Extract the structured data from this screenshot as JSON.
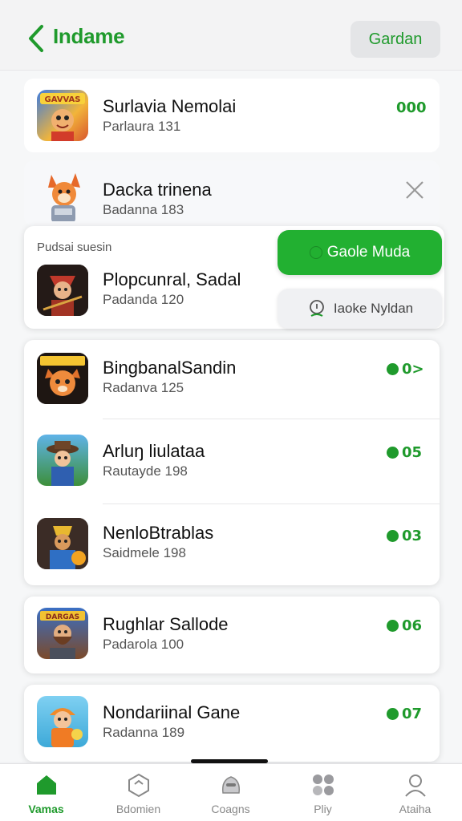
{
  "header": {
    "title": "Indame",
    "action_label": "Gardan"
  },
  "apps": [
    {
      "name": "Surlavia Nemolai",
      "subtitle": "Parlaura 131",
      "count": "000",
      "icon": "game-icon-gavvas"
    },
    {
      "name": "Dacka trinena",
      "subtitle": "Badanna 183",
      "icon": "game-icon-fox"
    },
    {
      "name": "Plopcunral, Sadal",
      "subtitle": "Padanda 120",
      "icon": "game-icon-warrior"
    },
    {
      "name": "BingbanalSandin",
      "subtitle": "Radanva 125",
      "count": "0>",
      "icon": "game-icon-cat"
    },
    {
      "name": "Arluŋ liulataa",
      "subtitle": "Rautayde 198",
      "count": "05",
      "icon": "game-icon-cowboy"
    },
    {
      "name": "NenloBtrablas",
      "subtitle": "Saidmele 198",
      "count": "03",
      "icon": "game-icon-robot"
    },
    {
      "name": "Rughlar Sallode",
      "subtitle": "Padarola 100",
      "count": "06",
      "icon": "game-icon-dwarf"
    },
    {
      "name": "Nondariinal Gane",
      "subtitle": "Radanna 189",
      "count": "07",
      "icon": "game-icon-hero"
    }
  ],
  "popup": {
    "label": "Pudsai suesin",
    "primary_button": "Gaole Muda",
    "secondary_button": "Iaoke Nyldan"
  },
  "tabs": [
    {
      "label": "Vamas",
      "icon": "home-icon",
      "active": true
    },
    {
      "label": "Bdomien",
      "icon": "hexagon-icon",
      "active": false
    },
    {
      "label": "Coagns",
      "icon": "controller-icon",
      "active": false
    },
    {
      "label": "Pliy",
      "icon": "apps-icon",
      "active": false
    },
    {
      "label": "Ataiha",
      "icon": "user-icon",
      "active": false
    }
  ],
  "colors": {
    "accent": "#1f9a2c",
    "button_green": "#22b031"
  }
}
